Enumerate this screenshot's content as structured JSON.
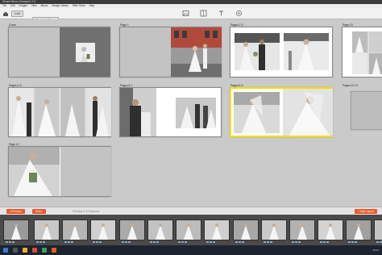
{
  "app": {
    "title": "Smart Album Designer 2.0",
    "menu": [
      "File",
      "Edit",
      "Images",
      "View",
      "Album",
      "Design Library",
      "Slide Show",
      "Help"
    ]
  },
  "toolbar": {
    "view_label": "Grid",
    "album_label": "Wedding Album",
    "tools": [
      "image-tool-icon",
      "layout-tool-icon",
      "text-tool-icon",
      "background-tool-icon"
    ]
  },
  "spreads": [
    {
      "label": "Cover"
    },
    {
      "label": "Page 1"
    },
    {
      "label": "Pages 2-3"
    },
    {
      "label": "Pages 4-5"
    },
    {
      "label": "Pages 6-7"
    },
    {
      "label": "Pages 8-9"
    },
    {
      "label": "Pages 10-11"
    },
    {
      "label": "Page 12"
    },
    {
      "label": "Page 13"
    }
  ],
  "bottombar": {
    "prev_label": "◂ Previous",
    "next_label": "Next ▸",
    "status": "Showing 9 of 9 spreads",
    "auto_label": "+ Auto Layout"
  },
  "taskbar": {
    "clock": "10:24"
  },
  "colors": {
    "accent": "#e85a2a",
    "selection": "#f3e000",
    "filmstrip": "#4a4a4a"
  }
}
